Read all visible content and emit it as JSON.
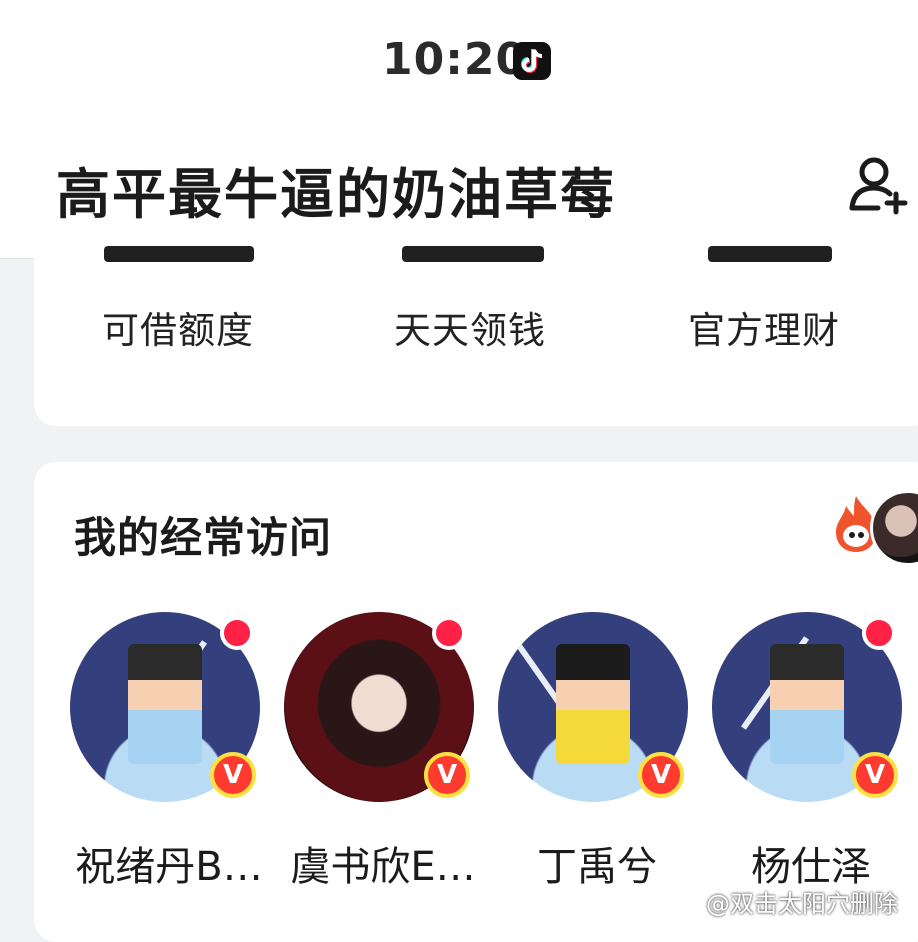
{
  "status_bar": {
    "time": "10:20"
  },
  "header": {
    "title": "高平最牛逼的奶油草莓"
  },
  "finance": {
    "items": [
      {
        "label": "可借额度"
      },
      {
        "label": "天天领钱"
      },
      {
        "label": "官方理财"
      }
    ]
  },
  "visited": {
    "title": "我的经常访问",
    "contacts": [
      {
        "name": "祝绪丹B…",
        "badge": "V"
      },
      {
        "name": "虞书欣E…",
        "badge": "V"
      },
      {
        "name": "丁禹兮",
        "badge": "V"
      },
      {
        "name": "杨仕泽",
        "badge": "V"
      }
    ]
  },
  "watermark": {
    "text": "@双击太阳穴删除"
  },
  "colors": {
    "new_dot": "#ff2146",
    "badge_red": "#ff3a2f",
    "badge_ring": "#fde042"
  }
}
